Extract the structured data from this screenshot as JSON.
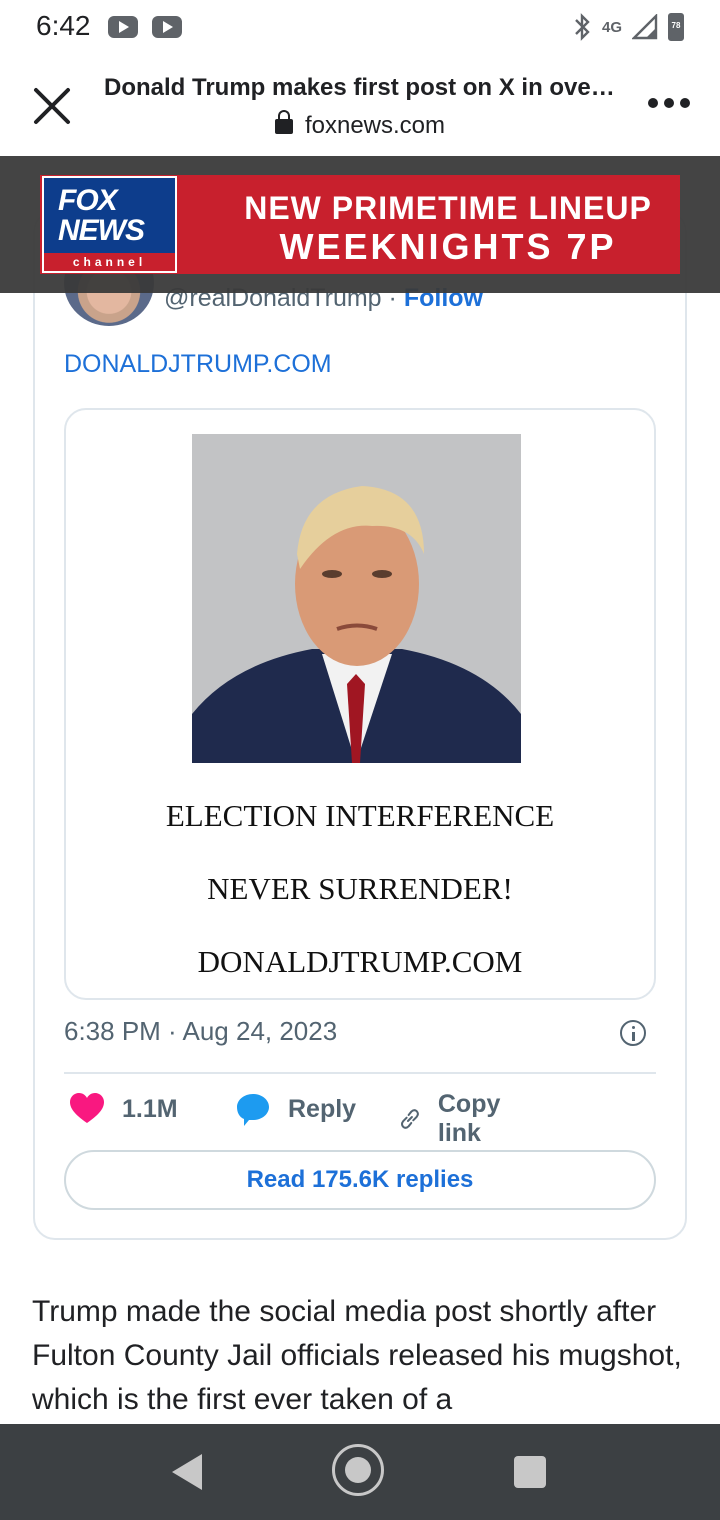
{
  "status_bar": {
    "time": "6:42",
    "network": "4G",
    "battery": "78"
  },
  "header": {
    "title": "Donald Trump makes first post on X in ove…",
    "url": "foxnews.com"
  },
  "ad": {
    "line1": "NEW PRIMETIME LINEUP",
    "line2": "WEEKNIGHTS 7P",
    "logo_fox": "FOX",
    "logo_news": "NEWS",
    "logo_channel": "channel"
  },
  "tweet": {
    "handle": "@realDonaldTrump",
    "separator": "·",
    "follow": "Follow",
    "link": "DONALDJTRUMP.COM",
    "media_lines": [
      "ELECTION INTERFERENCE",
      "NEVER SURRENDER!",
      "DONALDJTRUMP.COM"
    ],
    "timestamp": "6:38 PM · Aug 24, 2023",
    "likes": "1.1M",
    "reply": "Reply",
    "copy_link": "Copy link",
    "read_replies": "Read 175.6K replies"
  },
  "article": {
    "paragraph": "Trump made the social media post shortly after Fulton County Jail officials released his mugshot, which is the first ever taken of a"
  },
  "colors": {
    "link_blue": "#1d70d8",
    "heart": "#f91880",
    "reply_blue": "#1d9bf0",
    "ad_red": "#c8202d",
    "fox_blue": "#0d3d8c"
  }
}
